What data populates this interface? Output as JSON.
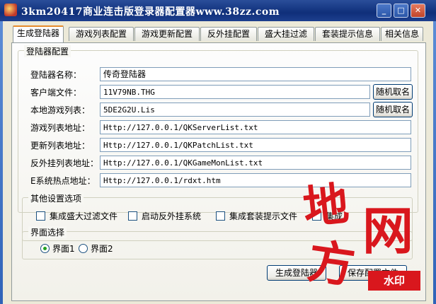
{
  "window": {
    "title": "3km20417商业连击版登录器配置器www.38zz.com"
  },
  "titlebar_buttons": {
    "minimize": "_",
    "restore": "□",
    "close": "✕"
  },
  "tabs": [
    {
      "label": "生成登陆器",
      "active": true
    },
    {
      "label": "游戏列表配置",
      "active": false
    },
    {
      "label": "游戏更新配置",
      "active": false
    },
    {
      "label": "反外挂配置",
      "active": false
    },
    {
      "label": "盛大挂过滤",
      "active": false
    },
    {
      "label": "套装提示信息",
      "active": false
    },
    {
      "label": "相关信息",
      "active": false
    }
  ],
  "config_group": {
    "title": "登陆器配置"
  },
  "fields": [
    {
      "label": "登陆器名称：",
      "value": "传奇登陆器"
    },
    {
      "label": "客户端文件：",
      "value": "11V79NB.THG",
      "button": "随机取名"
    },
    {
      "label": "本地游戏列表：",
      "value": "5DE2G2U.Lis",
      "button": "随机取名"
    },
    {
      "label": "游戏列表地址：",
      "value": "Http://127.0.0.1/QKServerList.txt"
    },
    {
      "label": "更新列表地址：",
      "value": "Http://127.0.0.1/QKPatchList.txt"
    },
    {
      "label": "反外挂列表地址：",
      "value": "Http://127.0.0.1/QKGameMonList.txt"
    },
    {
      "label": "E系统热点地址：",
      "value": "Http://127.0.0.1/rdxt.htm"
    }
  ],
  "other_group": {
    "title": "其他设置选项",
    "options": [
      {
        "label": "集成盛大过滤文件",
        "checked": false
      },
      {
        "label": "启动反外挂系统",
        "checked": false
      },
      {
        "label": "集成套装提示文件",
        "checked": false
      },
      {
        "label": "集成",
        "checked": false
      }
    ]
  },
  "ui_group": {
    "title": "界面选择",
    "options": [
      {
        "label": "界面1",
        "selected": true
      },
      {
        "label": "界面2",
        "selected": false
      }
    ]
  },
  "actions": {
    "generate": "生成登陆器",
    "save": "保存配置文件"
  },
  "watermark": {
    "chars": [
      "地",
      "网",
      "方"
    ],
    "badge": "水印",
    "color": "#d9171d"
  }
}
